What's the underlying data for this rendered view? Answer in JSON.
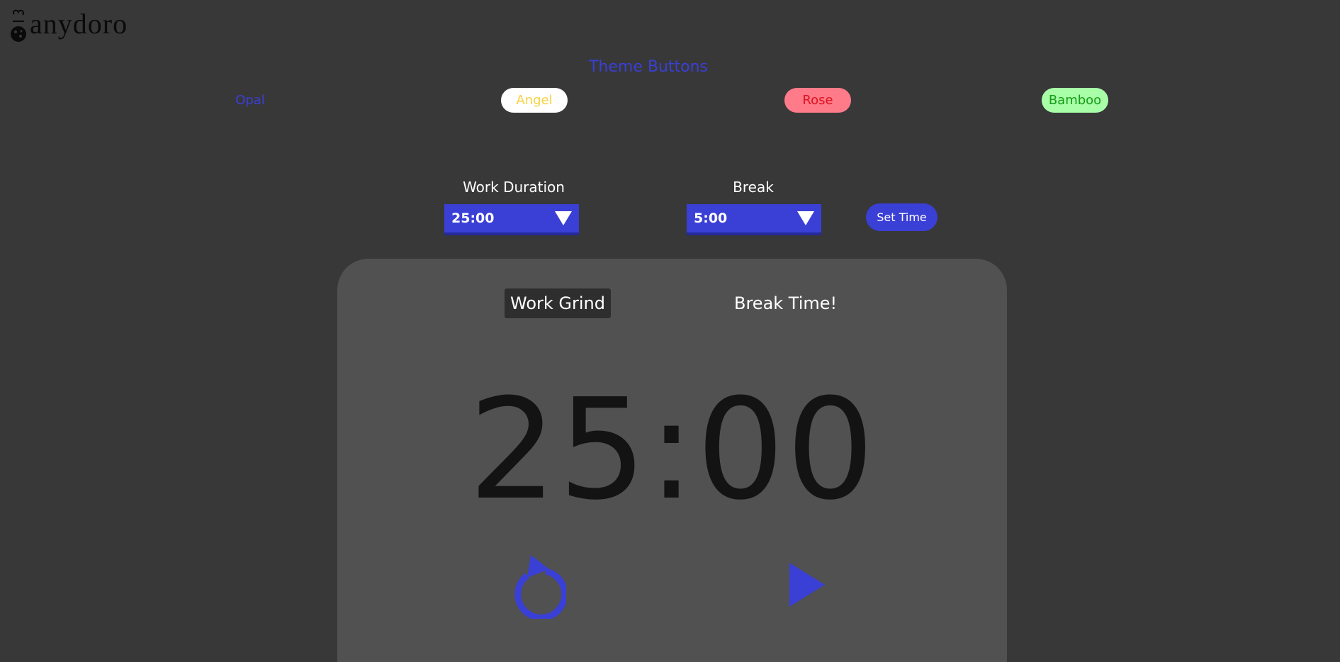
{
  "logo": {
    "text": "anydoro"
  },
  "theme": {
    "title": "Theme Buttons",
    "buttons": [
      {
        "label": "Opal"
      },
      {
        "label": "Angel"
      },
      {
        "label": "Rose"
      },
      {
        "label": "Bamboo"
      }
    ]
  },
  "settings": {
    "work": {
      "label": "Work Duration",
      "value": "25:00"
    },
    "break": {
      "label": "Break",
      "value": "5:00"
    },
    "set_label": "Set Time"
  },
  "timer": {
    "modes": {
      "work": "Work Grind",
      "break": "Break Time!"
    },
    "display": "25:00",
    "reset_icon": "reset-icon",
    "play_icon": "play-icon"
  },
  "colors": {
    "accent": "#3a3fd6",
    "background": "#383838",
    "card": "#515151"
  }
}
